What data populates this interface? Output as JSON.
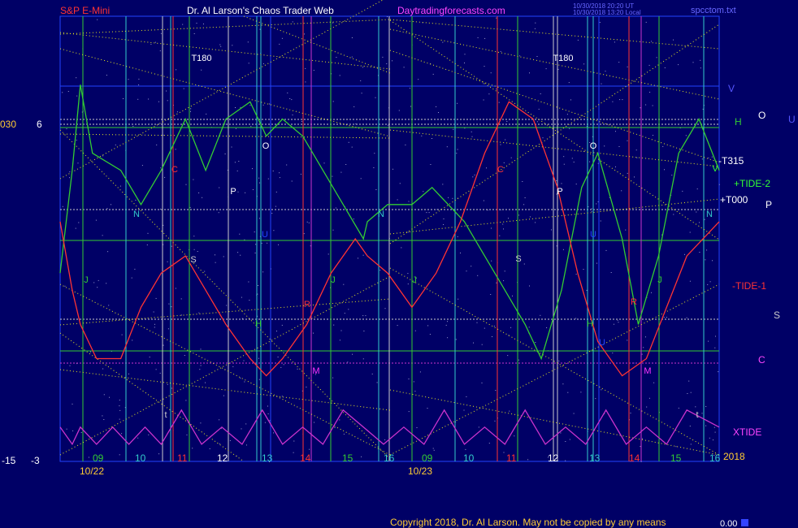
{
  "header": {
    "symbol": "S&P E-Mini",
    "author_title": "Dr. Al Larson's Chaos Trader Web",
    "website": "Daytradingforecasts.com",
    "stamp_line1": "10/30/2018 20:20 UT",
    "stamp_line2": "10/30/2018 13:20 Local",
    "filename": "spcctom.txt"
  },
  "footer": {
    "copyright": "Copyright 2018, Dr. Al Larson. May not be copied by any means",
    "readout": "0.00"
  },
  "left_scale": {
    "top_a": "030",
    "top_b": "6",
    "bottom_a": "-15",
    "bottom_b": "-3"
  },
  "right_labels": {
    "v": "V",
    "h": "H",
    "o": "O",
    "u": "U",
    "t315": "-T315",
    "tide2": "+TIDE-2",
    "t000": "+T000",
    "p": "P",
    "tide1": "-TIDE-1",
    "s": "S",
    "c": "C",
    "xtide": "XTIDE",
    "year": "2018"
  },
  "x_axis": {
    "hours": [
      "09",
      "10",
      "11",
      "12",
      "13",
      "14",
      "15",
      "16",
      "09",
      "10",
      "11",
      "12",
      "13",
      "14",
      "15",
      "16"
    ],
    "dates": [
      "10/22",
      "10/23"
    ]
  },
  "chart_data": {
    "type": "line",
    "title": "S&P E-Mini",
    "x_unit": "trading hour",
    "days": [
      "10/22",
      "10/23"
    ],
    "series": [
      {
        "name": "+TIDE-2",
        "color": "#33cc33",
        "points": [
          [
            8.5,
            -11
          ],
          [
            8.8,
            -5
          ],
          [
            9.0,
            0
          ],
          [
            9.3,
            -4
          ],
          [
            10.0,
            -5
          ],
          [
            10.5,
            -7
          ],
          [
            11.0,
            -5
          ],
          [
            11.6,
            -2
          ],
          [
            12.1,
            -5
          ],
          [
            12.6,
            -2
          ],
          [
            13.2,
            -1
          ],
          [
            13.6,
            -3
          ],
          [
            14.0,
            -2
          ],
          [
            14.5,
            -3
          ],
          [
            15.0,
            -5
          ],
          [
            15.5,
            -7
          ],
          [
            16.0,
            -9
          ],
          [
            16.1,
            -8
          ],
          [
            16.6,
            -7
          ],
          [
            17.2,
            -7
          ],
          [
            17.7,
            -6
          ],
          [
            18.1,
            -7
          ],
          [
            18.5,
            -8
          ],
          [
            19.0,
            -10
          ],
          [
            19.5,
            -12
          ],
          [
            20.0,
            -14
          ],
          [
            20.4,
            -16
          ],
          [
            20.9,
            -12
          ],
          [
            21.4,
            -6
          ],
          [
            21.8,
            -4
          ],
          [
            22.4,
            -9
          ],
          [
            22.8,
            -14
          ],
          [
            23.3,
            -10
          ],
          [
            23.8,
            -4
          ],
          [
            24.3,
            -2
          ],
          [
            24.8,
            -5
          ]
        ]
      },
      {
        "name": "-TIDE-1",
        "color": "#ff3333",
        "points": [
          [
            8.5,
            -8
          ],
          [
            8.8,
            -12
          ],
          [
            9.0,
            -14
          ],
          [
            9.4,
            -16
          ],
          [
            10.0,
            -16
          ],
          [
            10.5,
            -13
          ],
          [
            11.0,
            -11
          ],
          [
            11.6,
            -10
          ],
          [
            12.1,
            -12
          ],
          [
            12.6,
            -14
          ],
          [
            13.2,
            -16
          ],
          [
            13.6,
            -17
          ],
          [
            14.0,
            -16
          ],
          [
            14.6,
            -14
          ],
          [
            15.2,
            -11
          ],
          [
            15.8,
            -9
          ],
          [
            16.1,
            -10
          ],
          [
            16.6,
            -11
          ],
          [
            17.2,
            -13
          ],
          [
            17.8,
            -11
          ],
          [
            18.4,
            -8
          ],
          [
            19.0,
            -4
          ],
          [
            19.6,
            -1
          ],
          [
            20.2,
            -2
          ],
          [
            20.8,
            -6
          ],
          [
            21.3,
            -11
          ],
          [
            21.8,
            -15
          ],
          [
            22.4,
            -17
          ],
          [
            23.0,
            -16
          ],
          [
            23.5,
            -13
          ],
          [
            24.0,
            -10
          ],
          [
            24.8,
            -8
          ]
        ]
      },
      {
        "name": "XTIDE",
        "color": "#cc33cc",
        "points": [
          [
            8.5,
            -20
          ],
          [
            8.8,
            -21
          ],
          [
            9.0,
            -20
          ],
          [
            9.4,
            -21
          ],
          [
            9.8,
            -20
          ],
          [
            10.2,
            -21
          ],
          [
            10.6,
            -20
          ],
          [
            11.0,
            -21
          ],
          [
            11.5,
            -19
          ],
          [
            12.0,
            -21
          ],
          [
            12.5,
            -20
          ],
          [
            13.0,
            -21
          ],
          [
            13.5,
            -19
          ],
          [
            14.0,
            -21
          ],
          [
            14.5,
            -20
          ],
          [
            15.0,
            -21
          ],
          [
            15.5,
            -19
          ],
          [
            16.0,
            -20
          ],
          [
            16.5,
            -21
          ],
          [
            17.0,
            -20
          ],
          [
            17.5,
            -21
          ],
          [
            18.0,
            -19
          ],
          [
            18.5,
            -21
          ],
          [
            19.0,
            -20
          ],
          [
            19.5,
            -21
          ],
          [
            20.0,
            -19
          ],
          [
            20.5,
            -21
          ],
          [
            21.0,
            -20
          ],
          [
            21.5,
            -21
          ],
          [
            22.0,
            -19
          ],
          [
            22.5,
            -21
          ],
          [
            23.0,
            -20
          ],
          [
            23.5,
            -21
          ],
          [
            24.0,
            -19
          ],
          [
            24.8,
            -20
          ]
        ]
      }
    ],
    "annotations": [
      "T180",
      "T180",
      "C",
      "C",
      "N",
      "N",
      "N",
      "S",
      "S",
      "P",
      "P",
      "O",
      "O",
      "U",
      "U",
      "U",
      "J",
      "J",
      "J",
      "J",
      "R",
      "R",
      "H",
      "H",
      "M",
      "M",
      "t",
      "t",
      "V"
    ],
    "background_stars": true
  }
}
